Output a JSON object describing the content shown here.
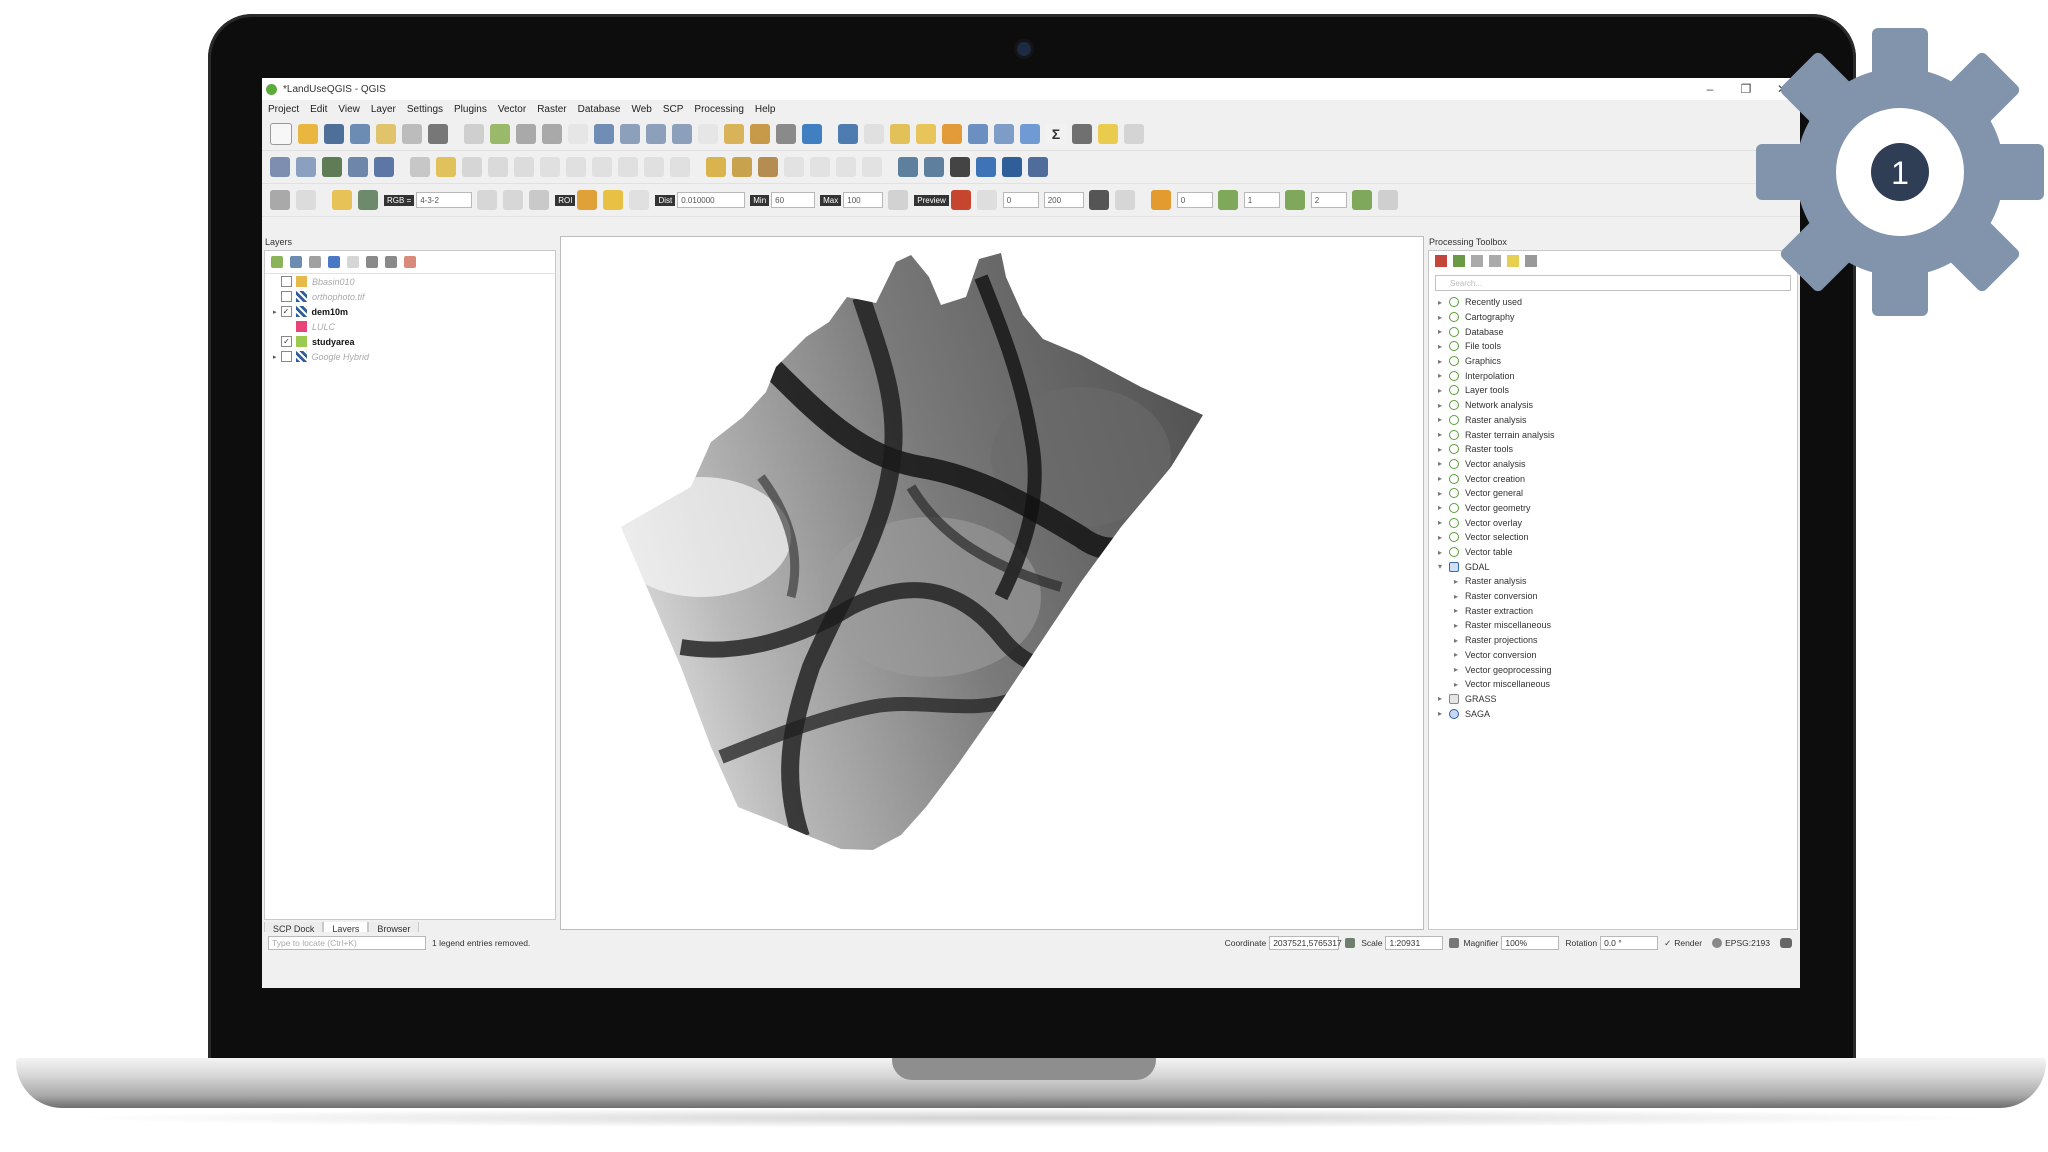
{
  "window": {
    "title": "*LandUseQGIS - QGIS"
  },
  "menu": [
    "Project",
    "Edit",
    "View",
    "Layer",
    "Settings",
    "Plugins",
    "Vector",
    "Raster",
    "Database",
    "Web",
    "SCP",
    "Processing",
    "Help"
  ],
  "toolbar3": {
    "band_combo": "RGB =",
    "band_value": "4-3-2",
    "dist_label": "Dist",
    "dist_value": "0.010000",
    "min_label": "Min",
    "min_value": "60",
    "max_label": "Max",
    "max_value": "100",
    "scale_value": "200",
    "f1": "0",
    "f2": "1",
    "f3": "2"
  },
  "layers_panel": {
    "title": "Layers",
    "items": [
      {
        "name": "Bbasin010",
        "checked": false,
        "style": "dim"
      },
      {
        "name": "orthophoto.tif",
        "checked": false,
        "style": "dim"
      },
      {
        "name": "dem10m",
        "checked": true,
        "style": "bold"
      },
      {
        "name": "LULC",
        "checked": false,
        "style": "dim"
      },
      {
        "name": "studyarea",
        "checked": true,
        "style": "bold"
      },
      {
        "name": "Google Hybrid",
        "checked": false,
        "style": "dim"
      }
    ],
    "tabs": [
      "SCP Dock",
      "Layers",
      "Browser"
    ],
    "active_tab": "Layers"
  },
  "toolbox": {
    "title": "Processing Toolbox",
    "search_placeholder": "Search...",
    "items": [
      "Recently used",
      "Cartography",
      "Database",
      "File tools",
      "Graphics",
      "Interpolation",
      "Layer tools",
      "Network analysis",
      "Raster analysis",
      "Raster terrain analysis",
      "Raster tools",
      "Vector analysis",
      "Vector creation",
      "Vector general",
      "Vector geometry",
      "Vector overlay",
      "Vector selection",
      "Vector table"
    ],
    "gdal_label": "GDAL",
    "gdal_children": [
      "Raster analysis",
      "Raster conversion",
      "Raster extraction",
      "Raster miscellaneous",
      "Raster projections",
      "Vector conversion",
      "Vector geoprocessing",
      "Vector miscellaneous"
    ],
    "grass_label": "GRASS",
    "saga_label": "SAGA"
  },
  "statusbar": {
    "locator_placeholder": "Type to locate (Ctrl+K)",
    "message": "1 legend entries removed.",
    "coordinate_label": "Coordinate",
    "coordinate_value": "2037521,5765317",
    "scale_label": "Scale",
    "scale_value": "1:20931",
    "magnifier_label": "Magnifier",
    "magnifier_value": "100%",
    "rotation_label": "Rotation",
    "rotation_value": "0.0 °",
    "render_label": "Render",
    "crs": "EPSG:2193"
  },
  "badge": {
    "number": "1",
    "gear_color": "#8294ac"
  }
}
